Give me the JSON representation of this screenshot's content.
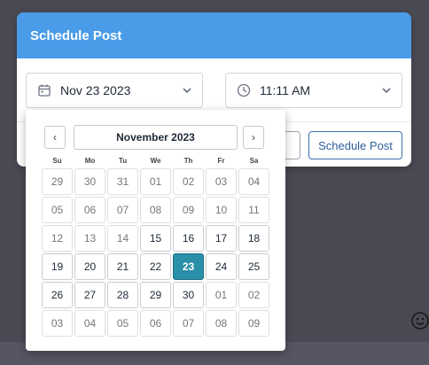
{
  "modal": {
    "title": "Schedule Post"
  },
  "date_field": {
    "value": "Nov 23 2023",
    "icon": "calendar-icon"
  },
  "time_field": {
    "value": "11:11 AM",
    "icon": "clock-icon"
  },
  "actions": {
    "schedule_label": "Schedule Post"
  },
  "datepicker": {
    "prev_label": "‹",
    "next_label": "›",
    "month_label": "November 2023",
    "weekdays": [
      "Su",
      "Mo",
      "Tu",
      "We",
      "Th",
      "Fr",
      "Sa"
    ],
    "weeks": [
      [
        {
          "d": "29",
          "s": "other"
        },
        {
          "d": "30",
          "s": "other"
        },
        {
          "d": "31",
          "s": "other"
        },
        {
          "d": "01",
          "s": "disabled"
        },
        {
          "d": "02",
          "s": "disabled"
        },
        {
          "d": "03",
          "s": "disabled"
        },
        {
          "d": "04",
          "s": "disabled"
        }
      ],
      [
        {
          "d": "05",
          "s": "disabled"
        },
        {
          "d": "06",
          "s": "disabled"
        },
        {
          "d": "07",
          "s": "disabled"
        },
        {
          "d": "08",
          "s": "disabled"
        },
        {
          "d": "09",
          "s": "disabled"
        },
        {
          "d": "10",
          "s": "disabled"
        },
        {
          "d": "11",
          "s": "disabled"
        }
      ],
      [
        {
          "d": "12",
          "s": "disabled"
        },
        {
          "d": "13",
          "s": "disabled"
        },
        {
          "d": "14",
          "s": "disabled"
        },
        {
          "d": "15",
          "s": "enabled"
        },
        {
          "d": "16",
          "s": "enabled"
        },
        {
          "d": "17",
          "s": "enabled"
        },
        {
          "d": "18",
          "s": "enabled"
        }
      ],
      [
        {
          "d": "19",
          "s": "enabled"
        },
        {
          "d": "20",
          "s": "enabled"
        },
        {
          "d": "21",
          "s": "enabled"
        },
        {
          "d": "22",
          "s": "enabled"
        },
        {
          "d": "23",
          "s": "selected"
        },
        {
          "d": "24",
          "s": "enabled"
        },
        {
          "d": "25",
          "s": "enabled"
        }
      ],
      [
        {
          "d": "26",
          "s": "enabled"
        },
        {
          "d": "27",
          "s": "enabled"
        },
        {
          "d": "28",
          "s": "enabled"
        },
        {
          "d": "29",
          "s": "enabled"
        },
        {
          "d": "30",
          "s": "enabled"
        },
        {
          "d": "01",
          "s": "other"
        },
        {
          "d": "02",
          "s": "other"
        }
      ],
      [
        {
          "d": "03",
          "s": "other"
        },
        {
          "d": "04",
          "s": "other"
        },
        {
          "d": "05",
          "s": "other"
        },
        {
          "d": "06",
          "s": "other"
        },
        {
          "d": "07",
          "s": "other"
        },
        {
          "d": "08",
          "s": "other"
        },
        {
          "d": "09",
          "s": "other"
        }
      ]
    ]
  },
  "colors": {
    "header": "#4a9ce8",
    "selected": "#2a8fa8",
    "backdrop": "#4a4a55"
  }
}
